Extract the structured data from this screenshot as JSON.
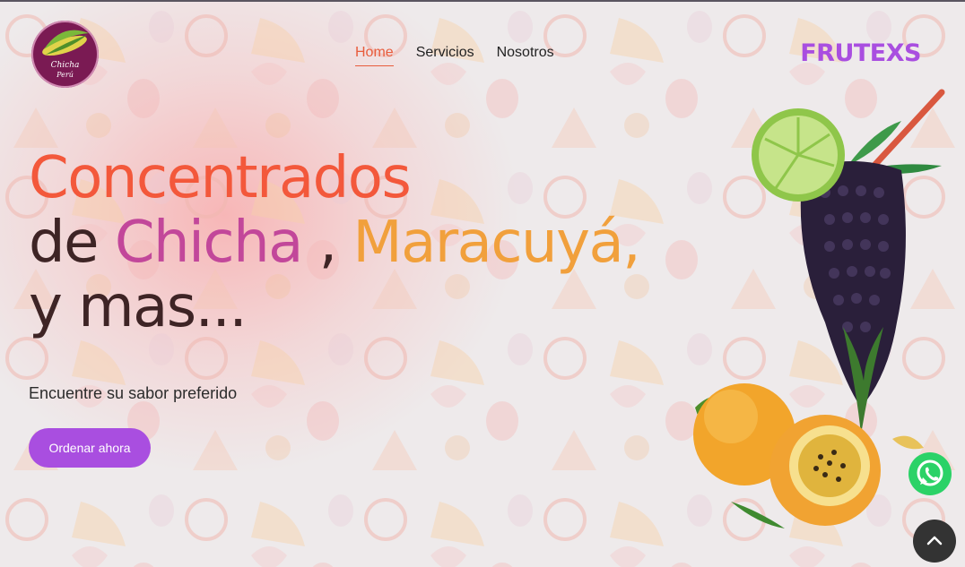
{
  "logo": {
    "line1": "Chicha",
    "line2": "Perú"
  },
  "nav": {
    "items": [
      {
        "label": "Home"
      },
      {
        "label": "Servicios"
      },
      {
        "label": "Nosotros"
      }
    ]
  },
  "brand": "FRUTEXS",
  "hero": {
    "line1": "Concentrados",
    "line2_a": "de ",
    "line2_b": "Chicha",
    "line2_c": " , ",
    "line2_d": "Maracuyá,",
    "line3": "y mas...",
    "subtitle": "Encuentre su sabor preferido",
    "cta_label": "Ordenar ahora"
  },
  "colors": {
    "accent_purple": "#a94ee0",
    "nav_active": "#e85c3c",
    "title_red": "#f3583b",
    "title_pink": "#c2479a",
    "title_orange": "#f1a03c",
    "title_dark": "#3e2425",
    "whatsapp_green": "#2bd267"
  },
  "icons": [
    "logo-corn-icon",
    "whatsapp-icon",
    "chevron-up-icon",
    "fruit-pattern",
    "chicha-drink-illustration"
  ]
}
